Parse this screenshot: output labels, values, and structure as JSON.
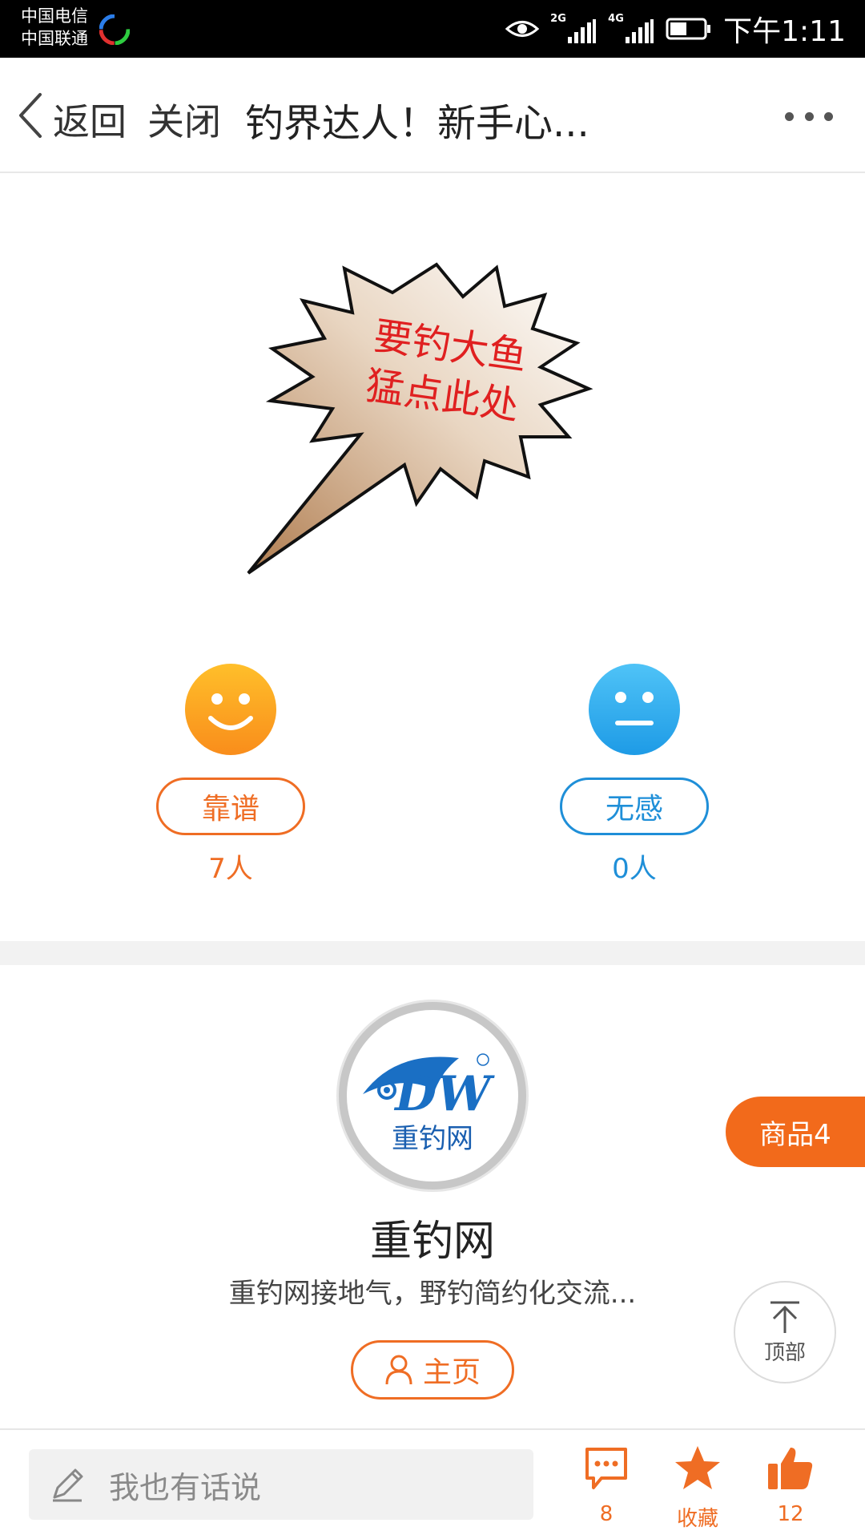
{
  "status_bar": {
    "carrier_1": "中国电信",
    "carrier_2": "中国联通",
    "network_1": "2G",
    "network_2": "4G",
    "time": "下午1:11"
  },
  "nav": {
    "back_label": "返回",
    "close_label": "关闭",
    "title": "钓界达人！新手心..."
  },
  "banner": {
    "text_line_1": "要钓大鱼",
    "text_line_2": "猛点此处"
  },
  "reactions": {
    "good": {
      "label": "靠谱",
      "count": "7人",
      "color": "#ef6d24"
    },
    "meh": {
      "label": "无感",
      "count": "0人",
      "color": "#1f8fd8"
    }
  },
  "author": {
    "name": "重钓网",
    "description": "重钓网接地气，野钓简约化交流...",
    "home_label": "主页",
    "logo_letters": "DW",
    "logo_caption": "重钓网"
  },
  "floating": {
    "goods_label": "商品4",
    "to_top_label": "顶部"
  },
  "bottom_bar": {
    "comment_placeholder": "我也有话说",
    "comment_count": "8",
    "favorite_label": "收藏",
    "like_count": "12"
  },
  "colors": {
    "accent": "#ef6d24",
    "accent_blue": "#1f8fd8",
    "goods_tab": "#f26a1b"
  },
  "icons": [
    "eye-icon",
    "signal-icon",
    "battery-icon",
    "back-icon",
    "more-icon",
    "smile-icon",
    "neutral-face-icon",
    "user-icon",
    "arrow-up-icon",
    "pencil-icon",
    "comment-icon",
    "star-icon",
    "thumbs-up-icon"
  ]
}
